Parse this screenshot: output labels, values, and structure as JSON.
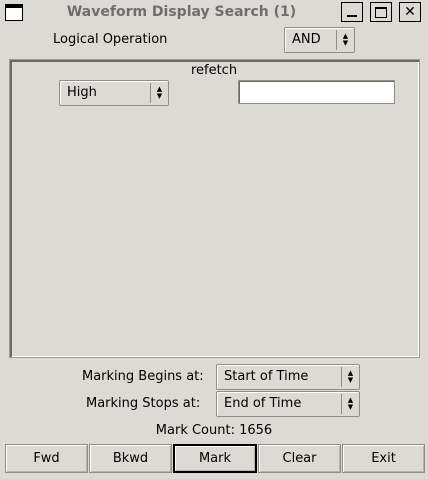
{
  "window": {
    "title": "Waveform Display Search (1)"
  },
  "logical_operation": {
    "label": "Logical Operation",
    "value": "AND"
  },
  "signal_panel": {
    "signal_name": "refetch",
    "condition_value": "High",
    "value_input": ""
  },
  "marking": {
    "begins_label": "Marking Begins at:",
    "begins_value": "Start of Time",
    "stops_label": "Marking Stops at:",
    "stops_value": "End of Time",
    "mark_count_text": "Mark Count: 1656"
  },
  "buttons": {
    "fwd": "Fwd",
    "bkwd": "Bkwd",
    "mark": "Mark",
    "clear": "Clear",
    "exit": "Exit"
  },
  "icons": {
    "window_menu": "window-menu-icon",
    "minimize": "minimize-icon",
    "maximize": "maximize-icon",
    "close": "close-icon",
    "spin_up_down": "updown-arrows-icon"
  }
}
